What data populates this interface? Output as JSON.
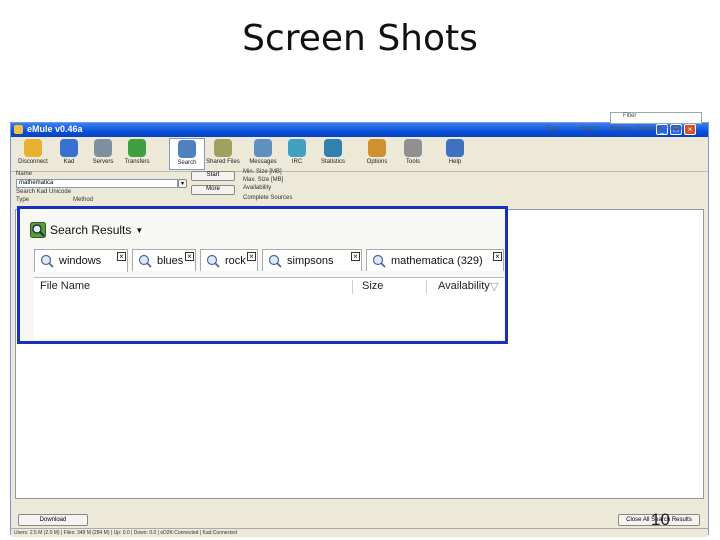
{
  "slide": {
    "title": "Screen Shots",
    "page_number": "10"
  },
  "window": {
    "title": "eMule v0.46a",
    "controls": [
      "_",
      "□",
      "×"
    ]
  },
  "toolbar": {
    "items": [
      {
        "label": "Disconnect",
        "color": "#e8b030"
      },
      {
        "label": "Kad",
        "color": "#3a70d0"
      },
      {
        "label": "Servers",
        "color": "#8090a0"
      },
      {
        "label": "Transfers",
        "color": "#40a040"
      },
      {
        "label": "Search",
        "color": "#5080c0",
        "active": true
      },
      {
        "label": "Shared Files",
        "color": "#a0a060"
      },
      {
        "label": "Messages",
        "color": "#6090c0"
      },
      {
        "label": "IRC",
        "color": "#40a0c0"
      },
      {
        "label": "Statistics",
        "color": "#3080b0"
      },
      {
        "label": "Options",
        "color": "#d09030"
      },
      {
        "label": "Tools",
        "color": "#909090"
      },
      {
        "label": "Help",
        "color": "#4070c0"
      }
    ]
  },
  "search_panel": {
    "name_label": "Name",
    "name_value": "mathematica",
    "unicode_label": "Search Kad Unicode",
    "type_label": "Type",
    "method_label": "Method",
    "start_button": "Start",
    "more_button": "More",
    "filters": [
      "Min. Size [MB]",
      "Max. Size [MB]",
      "Availability",
      "Complete Sources"
    ]
  },
  "zoom": {
    "header": "Search Results",
    "tabs": [
      {
        "label": "windows"
      },
      {
        "label": "blues"
      },
      {
        "label": "rock"
      },
      {
        "label": "simpsons"
      },
      {
        "label": "mathematica (329)"
      }
    ],
    "columns": {
      "name": "File Name",
      "size": "Size",
      "availability": "Availability"
    },
    "close_glyph": "⊠"
  },
  "right_area": {
    "filter_placeholder": "Filter",
    "columns": [
      "Type",
      "Search",
      "Sources",
      "Complete",
      "Folder"
    ]
  },
  "buttons": {
    "download": "Download",
    "download_all": "Close All Search Results"
  },
  "statusbar": {
    "text": "Users: 2.5 M (2.0 M) | Files: 348 M (284 M) | Up: 0.0 | Down: 0.0 | eD2K:Connected | Kad:Connected"
  },
  "colors": {
    "highlight_border": "#1a2ec0",
    "titlebar": "#0a50d8"
  }
}
